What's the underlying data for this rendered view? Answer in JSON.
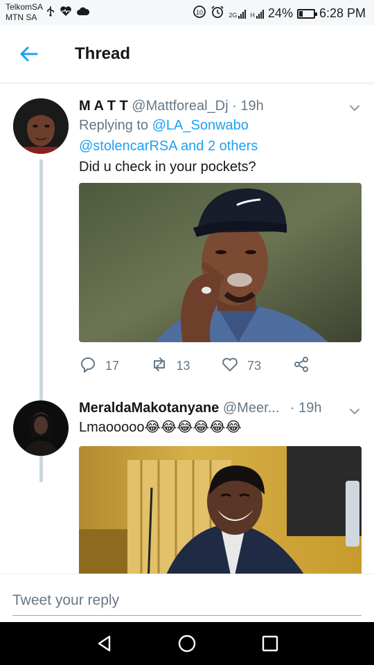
{
  "status_bar": {
    "carrier_1": "TelkomSA",
    "carrier_2": "MTN SA",
    "signal_label": "2G",
    "signal_label_2": "H",
    "battery_percent": "24%",
    "battery_level": 0.24,
    "time": "6:28 PM"
  },
  "header": {
    "title": "Thread"
  },
  "tweets": [
    {
      "display_name": "M A T T",
      "handle": "@Mattforeal_Dj",
      "time": "· 19h",
      "replying_prefix": "Replying to ",
      "replying_user": "@LA_Sonwabo",
      "replying_more": "@stolencarRSA and 2 others",
      "text": "Did u check in your pockets?",
      "replies": "17",
      "retweets": "13",
      "likes": "73"
    },
    {
      "display_name": "MeraldaMakotanyane",
      "handle": "@Meer...",
      "time": "· 19h",
      "text": "Lmaooooo😂😂😂😂😂😂"
    }
  ],
  "reply": {
    "placeholder": "Tweet your reply"
  },
  "colors": {
    "accent": "#1da1f2",
    "secondary_text": "#657786",
    "primary_text": "#14171a"
  }
}
